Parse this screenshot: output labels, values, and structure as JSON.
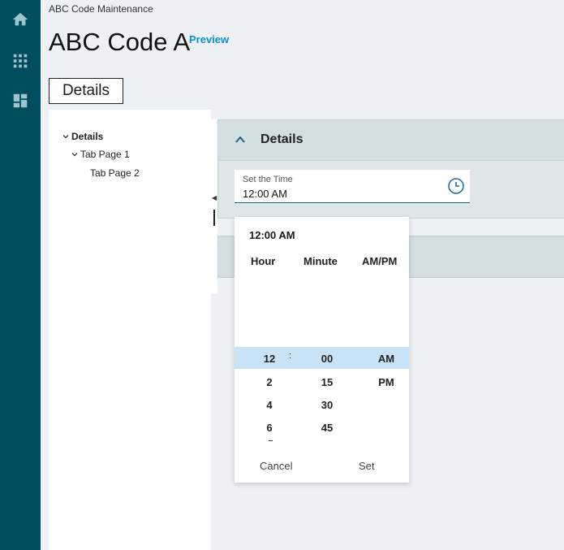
{
  "breadcrumb": "ABC Code Maintenance",
  "page": {
    "title": "ABC Code A",
    "preview_label": "Preview",
    "details_tab": "Details"
  },
  "tree": {
    "items": [
      {
        "label": "Details"
      },
      {
        "label": "Tab Page 1"
      },
      {
        "label": "Tab Page 2"
      }
    ]
  },
  "section": {
    "title": "Details"
  },
  "time_field": {
    "label": "Set the Time",
    "value": "12:00 AM"
  },
  "picker": {
    "current": "12:00 AM",
    "headers": {
      "hour": "Hour",
      "minute": "Minute",
      "ampm": "AM/PM"
    },
    "hours": [
      "12",
      "2",
      "4",
      "6"
    ],
    "minutes": [
      "00",
      "15",
      "30",
      "45"
    ],
    "periods": [
      "AM",
      "PM"
    ],
    "separator": ":",
    "cancel_label": "Cancel",
    "set_label": "Set"
  },
  "colors": {
    "rail": "#004e5d",
    "accent": "#0a8fd8",
    "selection": "#c7e3f5"
  },
  "icons": {
    "rail": [
      "home-icon",
      "apps-grid-icon",
      "dashboard-icon"
    ],
    "field": "clock-icon"
  }
}
